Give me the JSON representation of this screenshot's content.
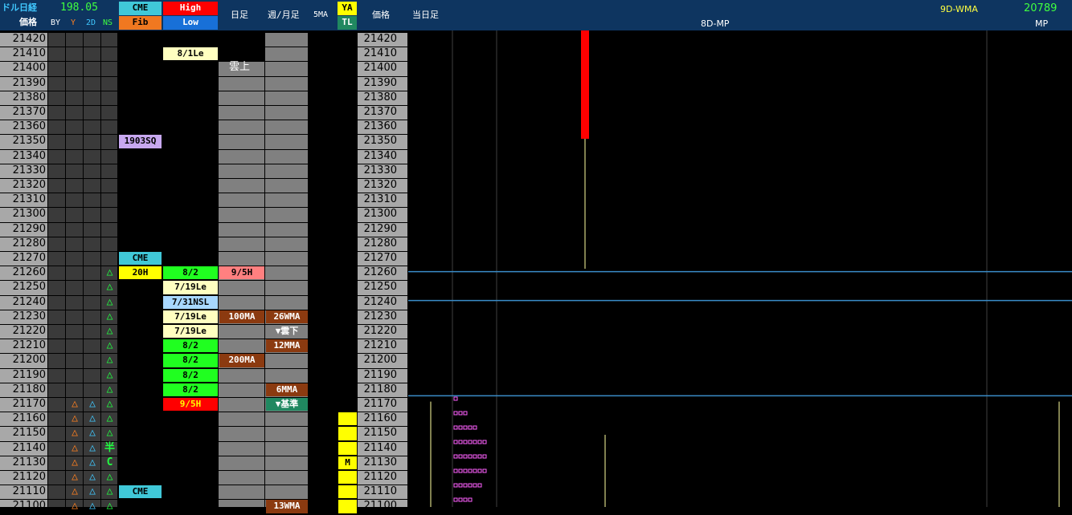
{
  "header": {
    "title": "ドル日経",
    "price_label": "価格",
    "usdjpy_value": "198.05",
    "col_by": "BY",
    "col_y": "Y",
    "col_2d": "2D",
    "col_ns": "NS",
    "cme_label": "CME",
    "fib_label": "Fib",
    "high_label": "High",
    "low_label": "Low",
    "daily_label": "日足",
    "weekly_monthly_label": "週/月足",
    "five_ma_label": "5MA",
    "ya_label": "YA",
    "tl_label": "TL",
    "price2_label": "価格",
    "today_label": "当日足",
    "mp_center_label": "8D-MP",
    "wma_label": "9D-WMA",
    "mp_value": "20789",
    "mp_label": "MP"
  },
  "prices": [
    "21420",
    "21410",
    "21400",
    "21390",
    "21380",
    "21370",
    "21360",
    "21350",
    "21340",
    "21330",
    "21320",
    "21310",
    "21300",
    "21290",
    "21280",
    "21270",
    "21260",
    "21250",
    "21240",
    "21230",
    "21220",
    "21210",
    "21200",
    "21190",
    "21180",
    "21170",
    "21160",
    "21150",
    "21140",
    "21130",
    "21120",
    "21110",
    "21100"
  ],
  "cells": [
    {
      "col": "hl",
      "row": 1,
      "text": "8/1Le",
      "bg": "#ffffc0",
      "fg": "#000000"
    },
    {
      "col": "cme",
      "row": 7,
      "text": "1903SQ",
      "bg": "#c8a8f0",
      "fg": "#000000"
    },
    {
      "col": "cme",
      "row": 15,
      "text": "CME",
      "bg": "#40c8d8",
      "fg": "#000000"
    },
    {
      "col": "cme",
      "row": 16,
      "text": "20H",
      "bg": "#ffff00",
      "fg": "#000000"
    },
    {
      "col": "hl",
      "row": 16,
      "text": "8/2",
      "bg": "#20ff20",
      "fg": "#000000"
    },
    {
      "col": "day",
      "row": 16,
      "text": "9/5H",
      "bg": "#ff8080",
      "fg": "#000000"
    },
    {
      "col": "hl",
      "row": 17,
      "text": "7/19Le",
      "bg": "#ffffc0",
      "fg": "#000000"
    },
    {
      "col": "hl",
      "row": 18,
      "text": "7/31NSL",
      "bg": "#a8d8ff",
      "fg": "#000000"
    },
    {
      "col": "hl",
      "row": 19,
      "text": "7/19Le",
      "bg": "#ffffc0",
      "fg": "#000000"
    },
    {
      "col": "day",
      "row": 19,
      "text": "100MA",
      "bg": "#8b3a10",
      "fg": "#ffffff"
    },
    {
      "col": "wk",
      "row": 19,
      "text": "26WMA",
      "bg": "#8b3a10",
      "fg": "#ffffff"
    },
    {
      "col": "hl",
      "row": 20,
      "text": "7/19Le",
      "bg": "#ffffc0",
      "fg": "#000000"
    },
    {
      "col": "wk",
      "row": 20,
      "text": "▼雲下",
      "bg": "#808080",
      "fg": "#ffffff"
    },
    {
      "col": "hl",
      "row": 21,
      "text": "8/2",
      "bg": "#20ff20",
      "fg": "#000000"
    },
    {
      "col": "wk",
      "row": 21,
      "text": "12MMA",
      "bg": "#8b3a10",
      "fg": "#ffffff"
    },
    {
      "col": "hl",
      "row": 22,
      "text": "8/2",
      "bg": "#20ff20",
      "fg": "#000000"
    },
    {
      "col": "day",
      "row": 22,
      "text": "200MA",
      "bg": "#8b3a10",
      "fg": "#ffffff"
    },
    {
      "col": "hl",
      "row": 23,
      "text": "8/2",
      "bg": "#20ff20",
      "fg": "#000000"
    },
    {
      "col": "hl",
      "row": 24,
      "text": "8/2",
      "bg": "#20ff20",
      "fg": "#000000"
    },
    {
      "col": "wk",
      "row": 24,
      "text": "6MMA",
      "bg": "#8b3a10",
      "fg": "#ffffff"
    },
    {
      "col": "hl",
      "row": 25,
      "text": "9/5H",
      "bg": "#ff0000",
      "fg": "#ffff00"
    },
    {
      "col": "wk",
      "row": 25,
      "text": "▼基準",
      "bg": "#208860",
      "fg": "#ffffff"
    },
    {
      "col": "ya",
      "row": 26,
      "text": "",
      "bg": "#ffff00",
      "fg": "#000000"
    },
    {
      "col": "ya",
      "row": 27,
      "text": "",
      "bg": "#ffff00",
      "fg": "#000000"
    },
    {
      "col": "ya",
      "row": 28,
      "text": "",
      "bg": "#ffff00",
      "fg": "#000000"
    },
    {
      "col": "ya",
      "row": 29,
      "text": "M",
      "bg": "#ffff00",
      "fg": "#000000"
    },
    {
      "col": "ya",
      "row": 30,
      "text": "",
      "bg": "#ffff00",
      "fg": "#000000"
    },
    {
      "col": "ya",
      "row": 31,
      "text": "",
      "bg": "#ffff00",
      "fg": "#000000"
    },
    {
      "col": "ya",
      "row": 32,
      "text": "",
      "bg": "#ffff00",
      "fg": "#000000"
    },
    {
      "col": "cme",
      "row": 31,
      "text": "CME",
      "bg": "#40c8d8",
      "fg": "#000000"
    },
    {
      "col": "wk",
      "row": 32,
      "text": "13WMA",
      "bg": "#8b3a10",
      "fg": "#ffffff"
    }
  ],
  "marks": [
    {
      "col": "ns",
      "row": 16,
      "text": "△",
      "color": "#20ff40"
    },
    {
      "col": "ns",
      "row": 17,
      "text": "△",
      "color": "#20ff40"
    },
    {
      "col": "ns",
      "row": 18,
      "text": "△",
      "color": "#20ff40"
    },
    {
      "col": "ns",
      "row": 19,
      "text": "△",
      "color": "#20ff40"
    },
    {
      "col": "ns",
      "row": 20,
      "text": "△",
      "color": "#20ff40"
    },
    {
      "col": "ns",
      "row": 21,
      "text": "△",
      "color": "#20ff40"
    },
    {
      "col": "ns",
      "row": 22,
      "text": "△",
      "color": "#20ff40"
    },
    {
      "col": "ns",
      "row": 23,
      "text": "△",
      "color": "#20ff40"
    },
    {
      "col": "ns",
      "row": 24,
      "text": "△",
      "color": "#20ff40"
    },
    {
      "col": "ns",
      "row": 25,
      "text": "△",
      "color": "#20ff40"
    },
    {
      "col": "ns",
      "row": 26,
      "text": "△",
      "color": "#20ff40"
    },
    {
      "col": "ns",
      "row": 27,
      "text": "△",
      "color": "#20ff40"
    },
    {
      "col": "ns",
      "row": 28,
      "text": "半",
      "color": "#20ff40"
    },
    {
      "col": "ns",
      "row": 29,
      "text": "C",
      "color": "#20ff40"
    },
    {
      "col": "ns",
      "row": 30,
      "text": "△",
      "color": "#20ff40"
    },
    {
      "col": "ns",
      "row": 31,
      "text": "△",
      "color": "#20ff40"
    },
    {
      "col": "ns",
      "row": 32,
      "text": "△",
      "color": "#20ff40"
    },
    {
      "col": "y",
      "row": 25,
      "text": "△",
      "color": "#ff8020"
    },
    {
      "col": "y",
      "row": 26,
      "text": "△",
      "color": "#ff8020"
    },
    {
      "col": "y",
      "row": 27,
      "text": "△",
      "color": "#ff8020"
    },
    {
      "col": "y",
      "row": 28,
      "text": "△",
      "color": "#ff8020"
    },
    {
      "col": "y",
      "row": 29,
      "text": "△",
      "color": "#ff8020"
    },
    {
      "col": "y",
      "row": 30,
      "text": "△",
      "color": "#ff8020"
    },
    {
      "col": "y",
      "row": 31,
      "text": "△",
      "color": "#ff8020"
    },
    {
      "col": "y",
      "row": 32,
      "text": "△",
      "color": "#ff8020"
    },
    {
      "col": "d2",
      "row": 25,
      "text": "△",
      "color": "#40c8ff"
    },
    {
      "col": "d2",
      "row": 26,
      "text": "△",
      "color": "#40c8ff"
    },
    {
      "col": "d2",
      "row": 27,
      "text": "△",
      "color": "#40c8ff"
    },
    {
      "col": "d2",
      "row": 28,
      "text": "△",
      "color": "#40c8ff"
    },
    {
      "col": "d2",
      "row": 29,
      "text": "△",
      "color": "#40c8ff"
    },
    {
      "col": "d2",
      "row": 30,
      "text": "△",
      "color": "#40c8ff"
    },
    {
      "col": "d2",
      "row": 31,
      "text": "△",
      "color": "#40c8ff"
    },
    {
      "col": "d2",
      "row": 32,
      "text": "△",
      "color": "#40c8ff"
    }
  ],
  "cloud": {
    "daily_label": "雲上"
  },
  "chart_data": {
    "type": "candlestick",
    "title": "",
    "xlabel": "",
    "ylabel": "価格",
    "ylim": [
      21095,
      21425
    ],
    "candles": [
      {
        "open": 21425,
        "close": 21350,
        "high": 21425,
        "low": 21260,
        "color": "#ff0000"
      }
    ],
    "horizontal_lines": [
      21258,
      21238,
      21172
    ],
    "market_profile": [
      {
        "price": 21170,
        "count": 1
      },
      {
        "price": 21160,
        "count": 3
      },
      {
        "price": 21150,
        "count": 5
      },
      {
        "price": 21140,
        "count": 7
      },
      {
        "price": 21130,
        "count": 7
      },
      {
        "price": 21120,
        "count": 7
      },
      {
        "price": 21110,
        "count": 6
      },
      {
        "price": 21100,
        "count": 4
      }
    ]
  },
  "colors": {
    "header_bg": "#0e3560",
    "price_col_bg": "#a8a8a8",
    "cloud_bg": "#808080",
    "grid": "#404040",
    "hline": "#3a8cc8",
    "profile": "#ff60ff",
    "value_green": "#40ff40",
    "value_yellow": "#ffff40"
  }
}
